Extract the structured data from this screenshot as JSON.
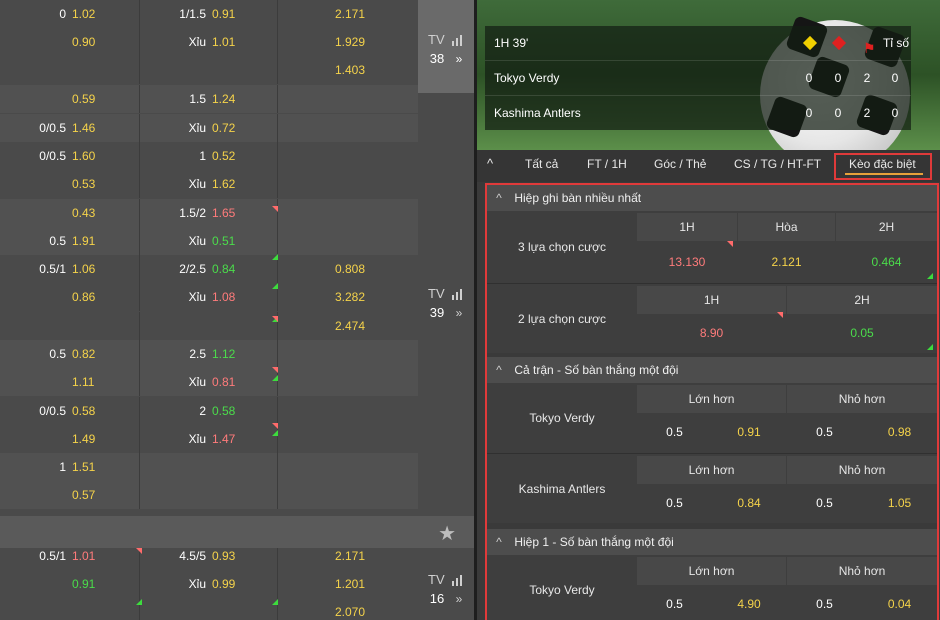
{
  "left_rows": [
    {
      "c1": "0",
      "c2": "1.02",
      "c3": "1/1.5",
      "c4": "0.91",
      "c5": "2.171"
    },
    {
      "c1": "",
      "c2": "0.90",
      "c3": "Xỉu",
      "c4": "1.01",
      "c5": "1.929"
    },
    {
      "c1": "",
      "c2": "",
      "c3": "",
      "c4": "",
      "c5": "1.403"
    },
    {
      "c1": "",
      "c2": "0.59",
      "c3": "1.5",
      "c4": "1.24",
      "c5": ""
    },
    {
      "c1": "0/0.5",
      "c2": "1.46",
      "c3": "Xỉu",
      "c4": "0.72",
      "c5": ""
    },
    {
      "c1": "0/0.5",
      "c2": "1.60",
      "c3": "1",
      "c4": "0.52",
      "c5": ""
    },
    {
      "c1": "",
      "c2": "0.53",
      "c3": "Xỉu",
      "c4": "1.62",
      "c5": ""
    },
    {
      "c1": "",
      "c2": "0.43",
      "c3": "1.5/2",
      "c4": "1.65",
      "c5": ""
    },
    {
      "c1": "0.5",
      "c2": "1.91",
      "c3": "Xỉu",
      "c4": "0.51",
      "c5": ""
    },
    {
      "c1": "0.5/1",
      "c2": "1.06",
      "c3": "2/2.5",
      "c4": "0.84",
      "c5": "0.808"
    },
    {
      "c1": "",
      "c2": "0.86",
      "c3": "Xỉu",
      "c4": "1.08",
      "c5": "3.282"
    },
    {
      "c1": "",
      "c2": "",
      "c3": "",
      "c4": "",
      "c5": "2.474"
    },
    {
      "c1": "0.5",
      "c2": "0.82",
      "c3": "2.5",
      "c4": "1.12",
      "c5": ""
    },
    {
      "c1": "",
      "c2": "1.11",
      "c3": "Xỉu",
      "c4": "0.81",
      "c5": ""
    },
    {
      "c1": "0/0.5",
      "c2": "0.58",
      "c3": "2",
      "c4": "0.58",
      "c5": ""
    },
    {
      "c1": "",
      "c2": "1.49",
      "c3": "Xỉu",
      "c4": "1.47",
      "c5": ""
    },
    {
      "c1": "1",
      "c2": "1.51",
      "c3": "",
      "c4": "",
      "c5": ""
    },
    {
      "c1": "",
      "c2": "0.57",
      "c3": "",
      "c4": "",
      "c5": ""
    },
    {
      "c1": "0.5/1",
      "c2": "1.01",
      "c3": "4.5/5",
      "c4": "0.93",
      "c5": "2.171"
    },
    {
      "c1": "",
      "c2": "0.91",
      "c3": "Xỉu",
      "c4": "0.99",
      "c5": "1.201"
    },
    {
      "c1": "",
      "c2": "",
      "c3": "",
      "c4": "",
      "c5": "2.070"
    }
  ],
  "tv": [
    {
      "label": "TV",
      "num": "38"
    },
    {
      "label": "TV",
      "num": "39"
    },
    {
      "label": "TV",
      "num": "16"
    }
  ],
  "match": {
    "time": "1H 39'",
    "score_label": "Tỉ số",
    "teams": [
      {
        "name": "Tokyo Verdy",
        "s1": "0",
        "s2": "0",
        "s3": "2",
        "s4": "0"
      },
      {
        "name": "Kashima Antlers",
        "s1": "0",
        "s2": "0",
        "s3": "2",
        "s4": "0"
      }
    ]
  },
  "tabs": [
    "Tất cả",
    "FT / 1H",
    "Góc / Thẻ",
    "CS / TG / HT-FT",
    "Kèo đặc biệt"
  ],
  "sections": {
    "s1": {
      "title": "Hiệp ghi bàn nhiều nhất",
      "r1": {
        "label": "3 lựa chọn cược",
        "h": [
          "1H",
          "Hòa",
          "2H"
        ],
        "v": [
          "13.130",
          "2.121",
          "0.464"
        ]
      },
      "r2": {
        "label": "2 lựa chọn cược",
        "h": [
          "1H",
          "2H"
        ],
        "v": [
          "8.90",
          "0.05"
        ]
      }
    },
    "s2": {
      "title": "Cả trận - Số bàn thắng một đội",
      "over": "Lớn hơn",
      "under": "Nhỏ hơn",
      "r1": {
        "team": "Tokyo Verdy",
        "l1": "0.5",
        "o1": "0.91",
        "l2": "0.5",
        "o2": "0.98"
      },
      "r2": {
        "team": "Kashima Antlers",
        "l1": "0.5",
        "o1": "0.84",
        "l2": "0.5",
        "o2": "1.05"
      }
    },
    "s3": {
      "title": "Hiệp 1 - Số bàn thắng một đội",
      "over": "Lớn hơn",
      "under": "Nhỏ hơn",
      "r1": {
        "team": "Tokyo Verdy",
        "l1": "0.5",
        "o1": "4.90",
        "l2": "0.5",
        "o2": "0.04"
      }
    }
  },
  "colors": {
    "accent_red": "#e03a3a",
    "odds_yellow": "#f5d34a",
    "odds_red": "#ff7b7b",
    "odds_green": "#4bdc4b"
  }
}
